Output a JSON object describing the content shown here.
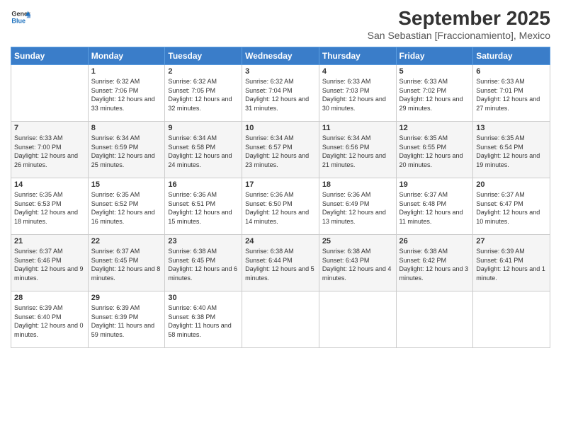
{
  "logo": {
    "line1": "General",
    "line2": "Blue"
  },
  "title": "September 2025",
  "subtitle": "San Sebastian [Fraccionamiento], Mexico",
  "days_header": [
    "Sunday",
    "Monday",
    "Tuesday",
    "Wednesday",
    "Thursday",
    "Friday",
    "Saturday"
  ],
  "weeks": [
    [
      {
        "day": "",
        "sunrise": "",
        "sunset": "",
        "daylight": ""
      },
      {
        "day": "1",
        "sunrise": "6:32 AM",
        "sunset": "7:06 PM",
        "daylight": "12 hours and 33 minutes."
      },
      {
        "day": "2",
        "sunrise": "6:32 AM",
        "sunset": "7:05 PM",
        "daylight": "12 hours and 32 minutes."
      },
      {
        "day": "3",
        "sunrise": "6:32 AM",
        "sunset": "7:04 PM",
        "daylight": "12 hours and 31 minutes."
      },
      {
        "day": "4",
        "sunrise": "6:33 AM",
        "sunset": "7:03 PM",
        "daylight": "12 hours and 30 minutes."
      },
      {
        "day": "5",
        "sunrise": "6:33 AM",
        "sunset": "7:02 PM",
        "daylight": "12 hours and 29 minutes."
      },
      {
        "day": "6",
        "sunrise": "6:33 AM",
        "sunset": "7:01 PM",
        "daylight": "12 hours and 27 minutes."
      }
    ],
    [
      {
        "day": "7",
        "sunrise": "6:33 AM",
        "sunset": "7:00 PM",
        "daylight": "12 hours and 26 minutes."
      },
      {
        "day": "8",
        "sunrise": "6:34 AM",
        "sunset": "6:59 PM",
        "daylight": "12 hours and 25 minutes."
      },
      {
        "day": "9",
        "sunrise": "6:34 AM",
        "sunset": "6:58 PM",
        "daylight": "12 hours and 24 minutes."
      },
      {
        "day": "10",
        "sunrise": "6:34 AM",
        "sunset": "6:57 PM",
        "daylight": "12 hours and 23 minutes."
      },
      {
        "day": "11",
        "sunrise": "6:34 AM",
        "sunset": "6:56 PM",
        "daylight": "12 hours and 21 minutes."
      },
      {
        "day": "12",
        "sunrise": "6:35 AM",
        "sunset": "6:55 PM",
        "daylight": "12 hours and 20 minutes."
      },
      {
        "day": "13",
        "sunrise": "6:35 AM",
        "sunset": "6:54 PM",
        "daylight": "12 hours and 19 minutes."
      }
    ],
    [
      {
        "day": "14",
        "sunrise": "6:35 AM",
        "sunset": "6:53 PM",
        "daylight": "12 hours and 18 minutes."
      },
      {
        "day": "15",
        "sunrise": "6:35 AM",
        "sunset": "6:52 PM",
        "daylight": "12 hours and 16 minutes."
      },
      {
        "day": "16",
        "sunrise": "6:36 AM",
        "sunset": "6:51 PM",
        "daylight": "12 hours and 15 minutes."
      },
      {
        "day": "17",
        "sunrise": "6:36 AM",
        "sunset": "6:50 PM",
        "daylight": "12 hours and 14 minutes."
      },
      {
        "day": "18",
        "sunrise": "6:36 AM",
        "sunset": "6:49 PM",
        "daylight": "12 hours and 13 minutes."
      },
      {
        "day": "19",
        "sunrise": "6:37 AM",
        "sunset": "6:48 PM",
        "daylight": "12 hours and 11 minutes."
      },
      {
        "day": "20",
        "sunrise": "6:37 AM",
        "sunset": "6:47 PM",
        "daylight": "12 hours and 10 minutes."
      }
    ],
    [
      {
        "day": "21",
        "sunrise": "6:37 AM",
        "sunset": "6:46 PM",
        "daylight": "12 hours and 9 minutes."
      },
      {
        "day": "22",
        "sunrise": "6:37 AM",
        "sunset": "6:45 PM",
        "daylight": "12 hours and 8 minutes."
      },
      {
        "day": "23",
        "sunrise": "6:38 AM",
        "sunset": "6:45 PM",
        "daylight": "12 hours and 6 minutes."
      },
      {
        "day": "24",
        "sunrise": "6:38 AM",
        "sunset": "6:44 PM",
        "daylight": "12 hours and 5 minutes."
      },
      {
        "day": "25",
        "sunrise": "6:38 AM",
        "sunset": "6:43 PM",
        "daylight": "12 hours and 4 minutes."
      },
      {
        "day": "26",
        "sunrise": "6:38 AM",
        "sunset": "6:42 PM",
        "daylight": "12 hours and 3 minutes."
      },
      {
        "day": "27",
        "sunrise": "6:39 AM",
        "sunset": "6:41 PM",
        "daylight": "12 hours and 1 minute."
      }
    ],
    [
      {
        "day": "28",
        "sunrise": "6:39 AM",
        "sunset": "6:40 PM",
        "daylight": "12 hours and 0 minutes."
      },
      {
        "day": "29",
        "sunrise": "6:39 AM",
        "sunset": "6:39 PM",
        "daylight": "11 hours and 59 minutes."
      },
      {
        "day": "30",
        "sunrise": "6:40 AM",
        "sunset": "6:38 PM",
        "daylight": "11 hours and 58 minutes."
      },
      {
        "day": "",
        "sunrise": "",
        "sunset": "",
        "daylight": ""
      },
      {
        "day": "",
        "sunrise": "",
        "sunset": "",
        "daylight": ""
      },
      {
        "day": "",
        "sunrise": "",
        "sunset": "",
        "daylight": ""
      },
      {
        "day": "",
        "sunrise": "",
        "sunset": "",
        "daylight": ""
      }
    ]
  ]
}
